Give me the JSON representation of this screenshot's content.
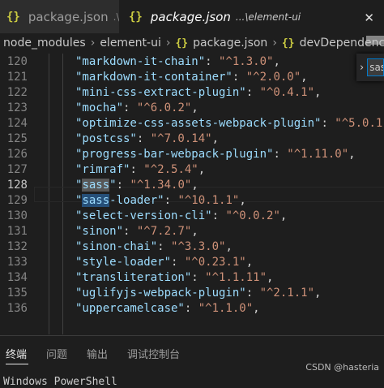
{
  "tabs": [
    {
      "icon": "json-braces-icon",
      "braces": "{}",
      "name": "package.json",
      "desc": ".\\",
      "active": false
    },
    {
      "icon": "json-braces-icon",
      "braces": "{}",
      "name": "package.json",
      "desc": "...\\element-ui",
      "active": true,
      "close": "✕"
    }
  ],
  "breadcrumb": {
    "items": [
      "node_modules",
      "element-ui",
      "package.json",
      "devDependencies"
    ],
    "braces": "{}"
  },
  "find_widget": {
    "chevron": "›",
    "value": "sas"
  },
  "editor": {
    "active_line": "128",
    "lines": [
      {
        "n": "120",
        "k": "\"markdown-it-chain\"",
        "v": "\"^1.3.0\""
      },
      {
        "n": "121",
        "k": "\"markdown-it-container\"",
        "v": "\"^2.0.0\""
      },
      {
        "n": "122",
        "k": "\"mini-css-extract-plugin\"",
        "v": "\"^0.4.1\""
      },
      {
        "n": "123",
        "k": "\"mocha\"",
        "v": "\"^6.0.2\""
      },
      {
        "n": "124",
        "k": "\"optimize-css-assets-webpack-plugin\"",
        "v": "\"^5.0.1\""
      },
      {
        "n": "125",
        "k": "\"postcss\"",
        "v": "\"^7.0.14\""
      },
      {
        "n": "126",
        "k": "\"progress-bar-webpack-plugin\"",
        "v": "\"^1.11.0\""
      },
      {
        "n": "127",
        "k": "\"rimraf\"",
        "v": "\"^2.5.4\""
      },
      {
        "n": "128",
        "kq": "\"",
        "khl": "sass",
        "kq2": "\"",
        "v": "\"^1.34.0\"",
        "hl": "word"
      },
      {
        "n": "129",
        "kq": "\"",
        "khl": "sass",
        "kq2": "-loader\"",
        "v": "\"^10.1.1\"",
        "hl": "sel"
      },
      {
        "n": "130",
        "k": "\"select-version-cli\"",
        "v": "\"^0.0.2\""
      },
      {
        "n": "131",
        "k": "\"sinon\"",
        "v": "\"^7.2.7\""
      },
      {
        "n": "132",
        "k": "\"sinon-chai\"",
        "v": "\"^3.3.0\""
      },
      {
        "n": "133",
        "k": "\"style-loader\"",
        "v": "\"^0.23.1\""
      },
      {
        "n": "134",
        "k": "\"transliteration\"",
        "v": "\"^1.1.11\""
      },
      {
        "n": "135",
        "k": "\"uglifyjs-webpack-plugin\"",
        "v": "\"^2.1.1\""
      },
      {
        "n": "136",
        "k": "\"uppercamelcase\"",
        "v": "\"^1.1.0\""
      }
    ]
  },
  "panel": {
    "tabs": [
      "终端",
      "问题",
      "输出",
      "调试控制台"
    ],
    "active": "终端",
    "terminal_text": "Windows PowerShell",
    "watermark": "CSDN @hasteria"
  }
}
